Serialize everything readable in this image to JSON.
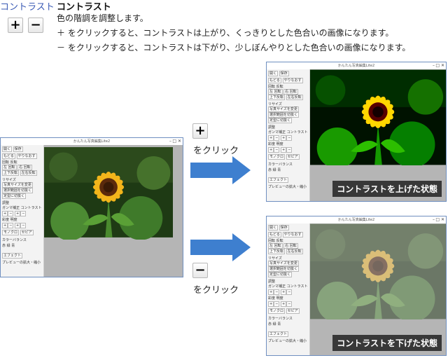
{
  "header": {
    "category": "コントラスト",
    "title": "コントラスト",
    "lines": [
      "色の階調を調整します。",
      "＋ をクリックすると、コントラストは上がり、くっきりとした色合いの画像になります。",
      "－ をクリックすると、コントラストは下がり、少しぼんやりとした色合いの画像になります。"
    ],
    "plus_label": "+",
    "minus_label": "−"
  },
  "steps": [
    {
      "button_label": "+",
      "text": "をクリック"
    },
    {
      "button_label": "−",
      "text": "をクリック"
    }
  ],
  "window": {
    "title": "かんたん写真編集Lite2",
    "open_label": "開く",
    "save_label": "保存",
    "back_label": "もどる",
    "redo_label": "やりなおす",
    "rotate_header": "回転  反転",
    "rotate_left": "左 回転",
    "rotate_right": "右 回転",
    "flip_v": "上下反転",
    "flip_h": "左右反転",
    "resize_header": "リサイズ",
    "resize_label": "写真サイズを変更",
    "crop_label": "選択範囲を切抜く",
    "shape_label": "定型に切抜く",
    "adjust_header": "調整",
    "gamma_label": "ガンマ補正",
    "contrast_label": "コントラスト",
    "sat_label": "彩度",
    "bright_label": "明度",
    "mono_label": "モノクロ",
    "sepia_label": "セピア",
    "color_header": "カラーバランス",
    "red": "赤",
    "green": "緑",
    "blue": "青",
    "effect_label": "エフェクト",
    "preview_label": "プレビューの拡大・縮小"
  },
  "captions": {
    "up": "コントラストを上げた状態",
    "down": "コントラストを下げた状態"
  },
  "colors": {
    "accent": "#3e7fcf",
    "window_border": "#6f8fc0",
    "caption_bg": "#141414"
  }
}
